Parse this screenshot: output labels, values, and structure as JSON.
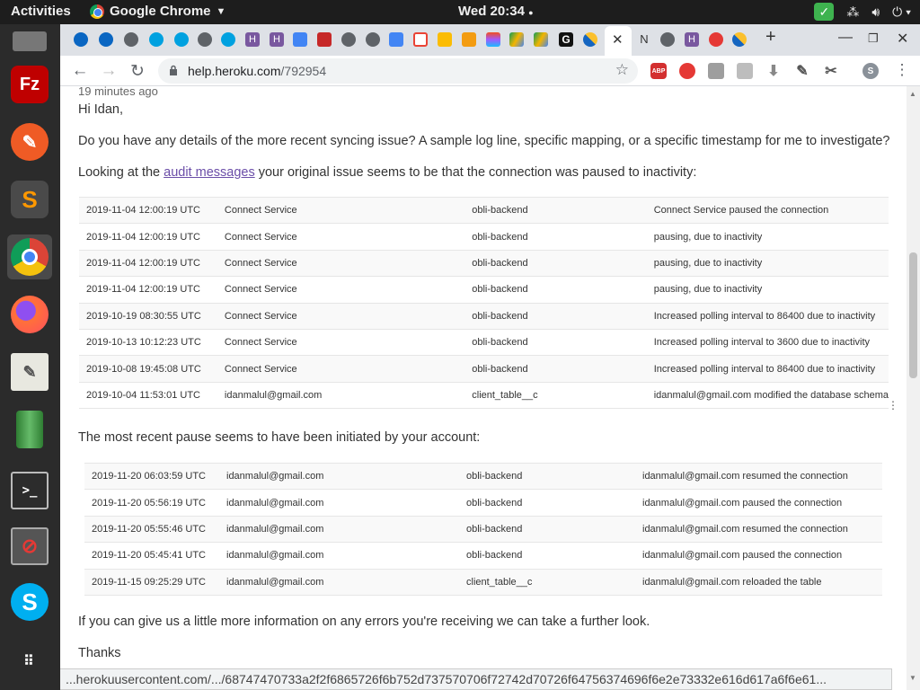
{
  "system": {
    "activities": "Activities",
    "app_name": "Google Chrome",
    "clock": "Wed 20:34"
  },
  "browser": {
    "url_host": "help.heroku.com",
    "url_path": "/792954",
    "profile_initial": "S",
    "abp_label": "ABP",
    "tab_letters": {
      "h1": "H",
      "h2": "H",
      "g": "G",
      "n": "N",
      "h3": "H"
    },
    "status_url": "...herokuusercontent.com/.../68747470733a2f2f6865726f6b752d737570706f72742d70726f64756374696f6e2e73332e616d617a6f6e61..."
  },
  "content": {
    "time_ago": "19 minutes ago",
    "greeting": "Hi Idan,",
    "para1": "Do you have any details of the more recent syncing issue? A sample log line, specific mapping, or a specific timestamp for me to investigate?",
    "para2_before": "Looking at the ",
    "para2_link": "audit messages",
    "para2_after": " your original issue seems to be that the connection was paused to inactivity:",
    "para3": "The most recent pause seems to have been initiated by your account:",
    "para4": "If you can give us a little more information on any errors you're receiving we can take a further look.",
    "closing": "Thanks",
    "table1": [
      [
        "2019-11-04 12:00:19 UTC",
        "Connect Service",
        "obli-backend",
        "Connect Service paused the connection"
      ],
      [
        "2019-11-04 12:00:19 UTC",
        "Connect Service",
        "obli-backend",
        "pausing, due to inactivity"
      ],
      [
        "2019-11-04 12:00:19 UTC",
        "Connect Service",
        "obli-backend",
        "pausing, due to inactivity"
      ],
      [
        "2019-11-04 12:00:19 UTC",
        "Connect Service",
        "obli-backend",
        "pausing, due to inactivity"
      ],
      [
        "2019-10-19 08:30:55 UTC",
        "Connect Service",
        "obli-backend",
        "Increased polling interval to 86400 due to inactivity"
      ],
      [
        "2019-10-13 10:12:23 UTC",
        "Connect Service",
        "obli-backend",
        "Increased polling interval to 3600 due to inactivity"
      ],
      [
        "2019-10-08 19:45:08 UTC",
        "Connect Service",
        "obli-backend",
        "Increased polling interval to 86400 due to inactivity"
      ],
      [
        "2019-10-04 11:53:01 UTC",
        "idanmalul@gmail.com",
        "client_table__c",
        "idanmalul@gmail.com modified the database schema"
      ]
    ],
    "table2": [
      [
        "2019-11-20 06:03:59 UTC",
        "idanmalul@gmail.com",
        "obli-backend",
        "idanmalul@gmail.com resumed the connection"
      ],
      [
        "2019-11-20 05:56:19 UTC",
        "idanmalul@gmail.com",
        "obli-backend",
        "idanmalul@gmail.com paused the connection"
      ],
      [
        "2019-11-20 05:55:46 UTC",
        "idanmalul@gmail.com",
        "obli-backend",
        "idanmalul@gmail.com resumed the connection"
      ],
      [
        "2019-11-20 05:45:41 UTC",
        "idanmalul@gmail.com",
        "obli-backend",
        "idanmalul@gmail.com paused the connection"
      ],
      [
        "2019-11-15 09:25:29 UTC",
        "idanmalul@gmail.com",
        "client_table__c",
        "idanmalul@gmail.com reloaded the table"
      ]
    ]
  }
}
